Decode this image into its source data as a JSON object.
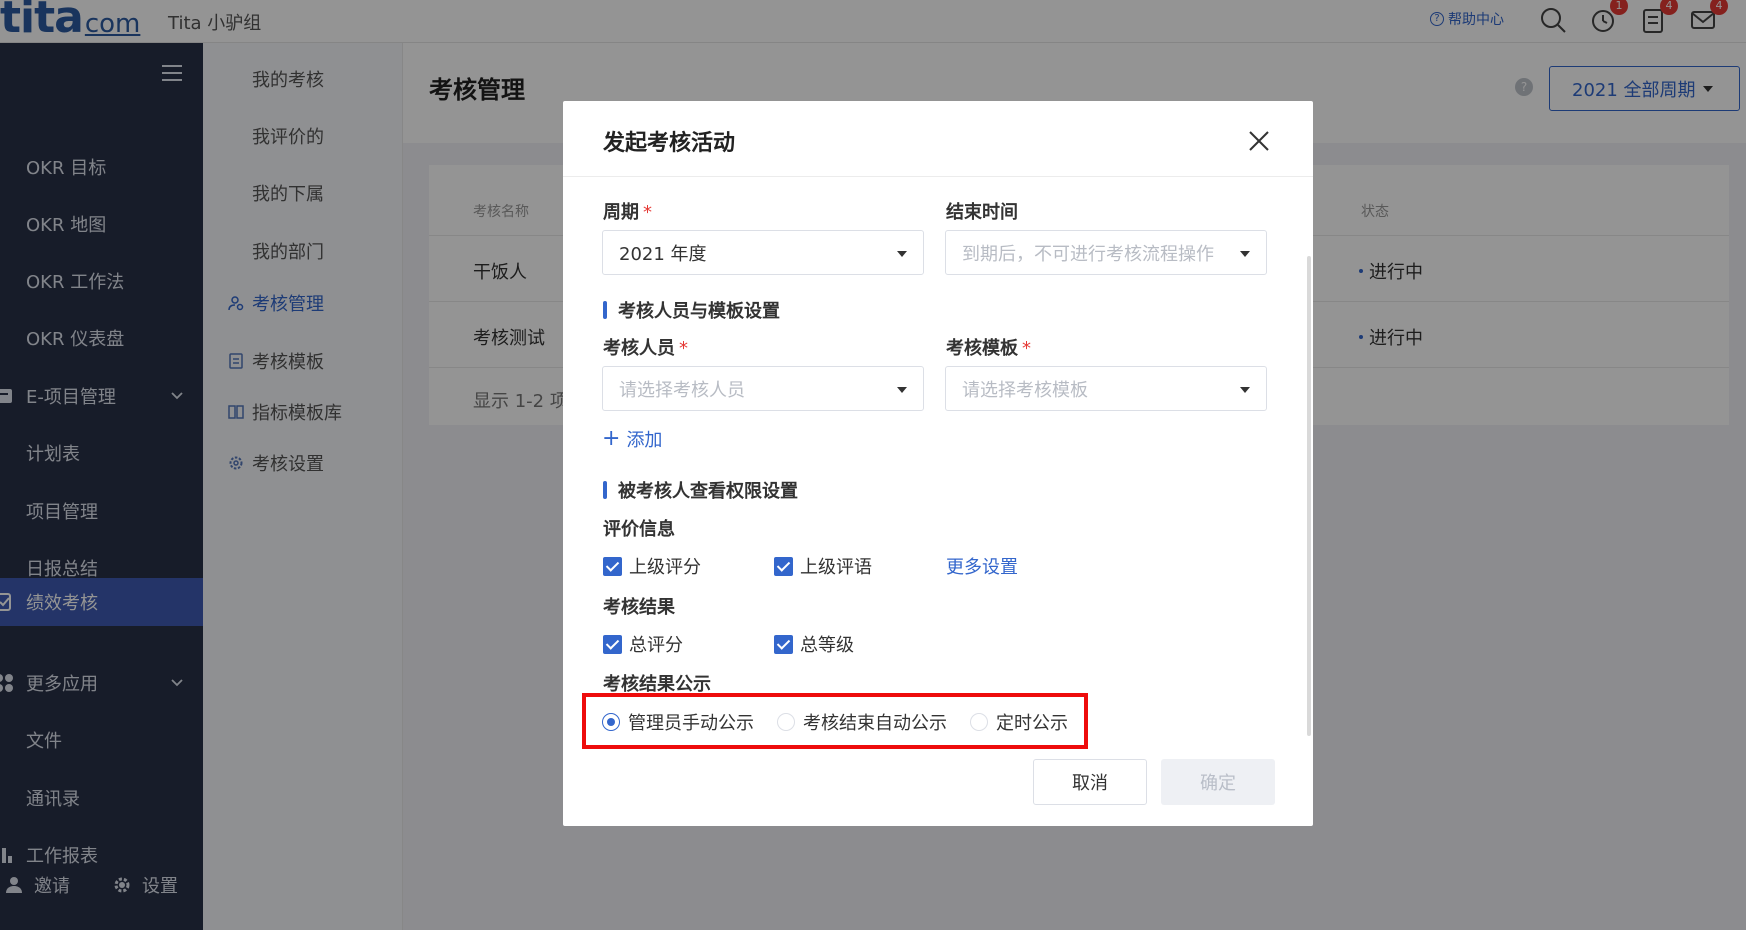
{
  "topbar": {
    "logo_main": "tita",
    "logo_com": "com",
    "org_name": "Tita 小驴组",
    "help_label": "帮助中心",
    "icons": [
      "search-icon",
      "alarm-icon",
      "approval-icon",
      "mail-icon"
    ],
    "badges": {
      "alarm": "1",
      "approval": "4",
      "mail": "4"
    }
  },
  "sidebar": {
    "items": [
      {
        "label": "OKR 目标"
      },
      {
        "label": "OKR 地图"
      },
      {
        "label": "OKR 工作法"
      },
      {
        "label": "OKR 仪表盘"
      },
      {
        "label": "E-项目管理",
        "icon": "project-icon",
        "expandable": true
      },
      {
        "label": "计划表"
      },
      {
        "label": "项目管理"
      },
      {
        "label": "日报总结"
      },
      {
        "label": "绩效考核",
        "icon": "performance-icon",
        "active": true
      },
      {
        "label": "更多应用",
        "icon": "apps-icon",
        "expandable": true
      },
      {
        "label": "文件"
      },
      {
        "label": "通讯录"
      },
      {
        "label": "工作报表",
        "icon": "report-icon"
      }
    ],
    "invite_label": "邀请",
    "settings_label": "设置"
  },
  "subnav": {
    "items": [
      {
        "label": "我的考核"
      },
      {
        "label": "我评价的"
      },
      {
        "label": "我的下属"
      },
      {
        "label": "我的部门"
      },
      {
        "label": "考核管理",
        "icon": "user-manage-icon",
        "active": true
      },
      {
        "label": "考核模板",
        "icon": "template-icon"
      },
      {
        "label": "指标模板库",
        "icon": "library-icon"
      },
      {
        "label": "考核设置",
        "icon": "gear-icon"
      }
    ]
  },
  "main": {
    "title": "考核管理",
    "help_mark": "?",
    "period_button": "2021 全部周期",
    "table": {
      "headers": {
        "name": "考核名称",
        "status": "状态"
      },
      "rows": [
        {
          "name": "干饭人",
          "status": "进行中"
        },
        {
          "name": "考核测试",
          "status": "进行中"
        }
      ],
      "pager": "显示 1-2 项"
    }
  },
  "modal": {
    "title": "发起考核活动",
    "period": {
      "label": "周期",
      "required_mark": "*",
      "value": "2021 年度"
    },
    "end_time": {
      "label": "结束时间",
      "placeholder": "到期后，不可进行考核流程操作"
    },
    "section_staff": "考核人员与模板设置",
    "reviewers": {
      "label": "考核人员",
      "required_mark": "*",
      "placeholder": "请选择考核人员"
    },
    "template": {
      "label": "考核模板",
      "required_mark": "*",
      "placeholder": "请选择考核模板"
    },
    "add_link": "添加",
    "add_plus": "+",
    "section_permission": "被考核人查看权限设置",
    "eval_info": {
      "label": "评价信息",
      "options": [
        {
          "label": "上级评分",
          "checked": true
        },
        {
          "label": "上级评语",
          "checked": true
        }
      ],
      "more_link": "更多设置"
    },
    "result": {
      "label": "考核结果",
      "options": [
        {
          "label": "总评分",
          "checked": true
        },
        {
          "label": "总等级",
          "checked": true
        }
      ]
    },
    "publish": {
      "label": "考核结果公示",
      "options": [
        {
          "label": "管理员手动公示",
          "selected": true
        },
        {
          "label": "考核结束自动公示",
          "selected": false
        },
        {
          "label": "定时公示",
          "selected": false
        }
      ]
    },
    "cancel_label": "取消",
    "ok_label": "确定"
  },
  "colors": {
    "accent": "#3366cc",
    "sidebar_bg": "#293147",
    "sidebar_active": "#3e5bb3",
    "highlight_box": "#ee0c0c",
    "badge": "#e53935"
  }
}
